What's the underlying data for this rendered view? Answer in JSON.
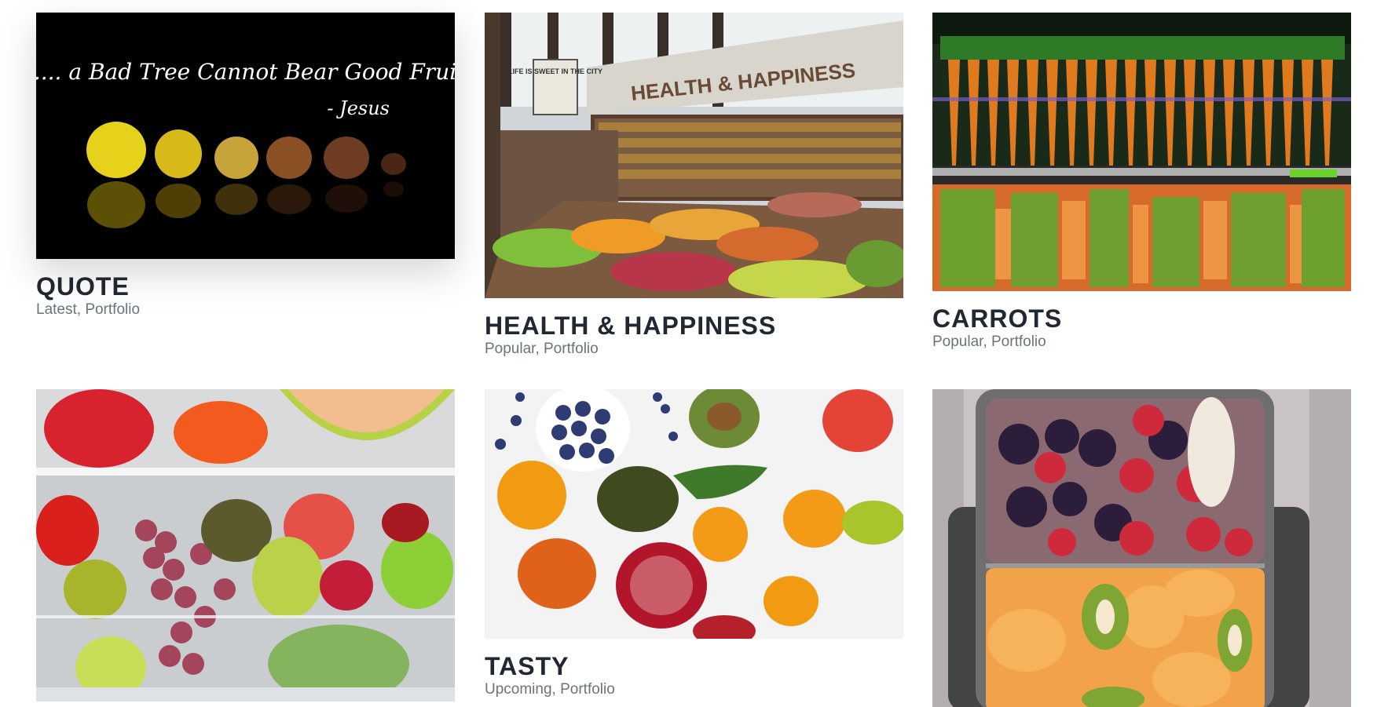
{
  "portfolio": {
    "cards": [
      {
        "title": "QUOTE",
        "meta": "Latest, Portfolio",
        "image_text": {
          "quote": ".... a Bad Tree Cannot Bear Good Fruit...",
          "author": "- Jesus"
        }
      },
      {
        "title": "HEALTH & HAPPINESS",
        "meta": "Popular, Portfolio",
        "image_text": {
          "store_sign": "HEALTH & HAPPINESS",
          "wall_sign": "LIFE IS SWEET IN THE CITY"
        }
      },
      {
        "title": "CARROTS",
        "meta": "Popular, Portfolio"
      },
      {
        "title": "",
        "meta": ""
      },
      {
        "title": "TASTY",
        "meta": "Upcoming, Portfolio"
      },
      {
        "title": "",
        "meta": ""
      }
    ]
  },
  "colors": {
    "title": "#222831",
    "meta": "#6b737b",
    "background": "#ffffff"
  }
}
